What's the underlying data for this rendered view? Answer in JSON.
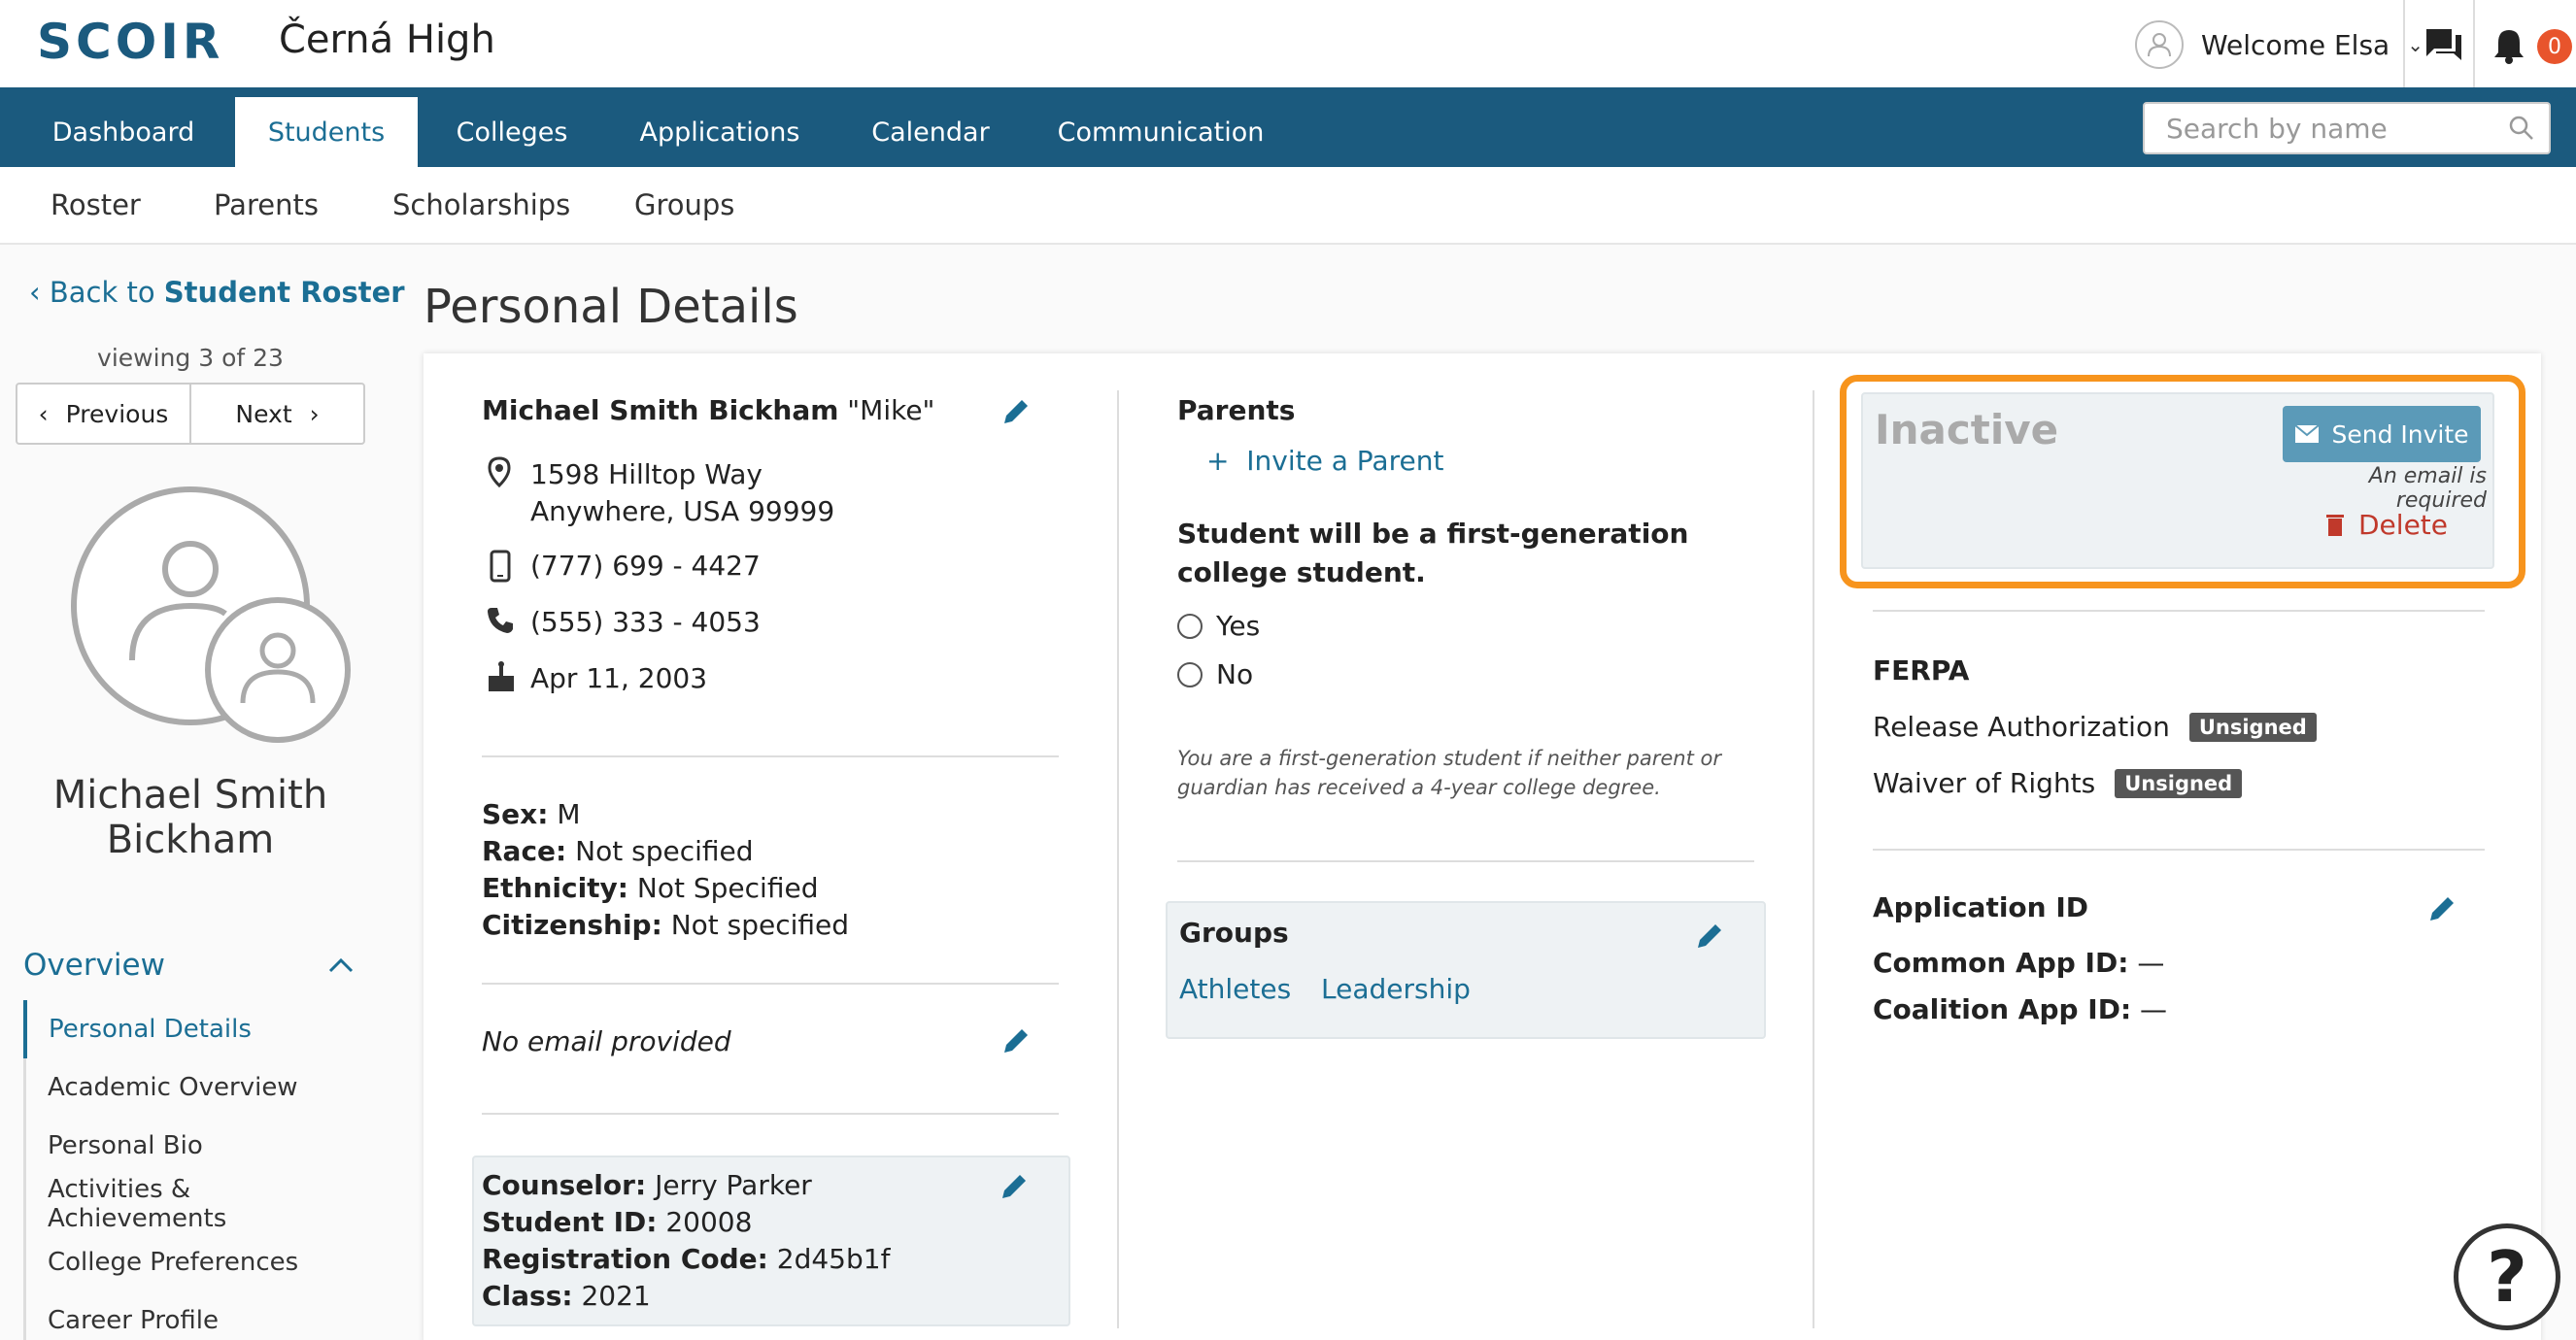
{
  "header": {
    "logo": "SCOIR",
    "school": "Černá High",
    "welcome": "Welcome Elsa",
    "notification_count": "0"
  },
  "mainnav": {
    "tabs": [
      {
        "label": "Dashboard"
      },
      {
        "label": "Students",
        "active": true
      },
      {
        "label": "Colleges"
      },
      {
        "label": "Applications"
      },
      {
        "label": "Calendar"
      },
      {
        "label": "Communication"
      }
    ],
    "search_placeholder": "Search by name"
  },
  "subnav": {
    "tabs": [
      "Roster",
      "Parents",
      "Scholarships",
      "Groups"
    ]
  },
  "sidebar": {
    "back_prefix": "Back to",
    "back_target": "Student Roster",
    "viewing": "viewing 3 of 23",
    "previous": "Previous",
    "next": "Next",
    "student_first": "Michael Smith",
    "student_last": "Bickham",
    "section": "Overview",
    "menu": [
      "Personal Details",
      "Academic Overview",
      "Personal Bio",
      "Activities & Achievements",
      "College Preferences",
      "Career Profile"
    ]
  },
  "page": {
    "title": "Personal Details"
  },
  "contact": {
    "full_name": "Michael Smith Bickham",
    "nickname": "\"Mike\"",
    "address1": "1598 Hilltop Way",
    "address2": "Anywhere, USA 99999",
    "mobile": "(777) 699 - 4427",
    "phone": "(555) 333 - 4053",
    "birthday": "Apr 11, 2003"
  },
  "demographics": {
    "sex_label": "Sex:",
    "sex": "M",
    "race_label": "Race:",
    "race": "Not specified",
    "ethnicity_label": "Ethnicity:",
    "ethnicity": "Not Specified",
    "citizenship_label": "Citizenship:",
    "citizenship": "Not specified"
  },
  "email": {
    "text": "No email provided"
  },
  "school_info": {
    "counselor_label": "Counselor:",
    "counselor": "Jerry Parker",
    "student_id_label": "Student ID:",
    "student_id": "20008",
    "reg_label": "Registration Code:",
    "reg": "2d45b1f",
    "class_label": "Class:",
    "class": "2021"
  },
  "parents": {
    "title": "Parents",
    "invite": "Invite a Parent",
    "firstgen_question": "Student will be a first-generation college student.",
    "yes": "Yes",
    "no": "No",
    "firstgen_note": "You are a first-generation student if neither parent or guardian has received a 4-year college degree."
  },
  "groups": {
    "title": "Groups",
    "items": [
      "Athletes",
      "Leadership"
    ]
  },
  "status": {
    "state": "Inactive",
    "send_invite": "Send Invite",
    "email_required": "An email is required",
    "delete": "Delete",
    "highlight_color": "#f7941d"
  },
  "ferpa": {
    "title": "FERPA",
    "release": "Release Authorization",
    "release_status": "Unsigned",
    "waiver": "Waiver of Rights",
    "waiver_status": "Unsigned"
  },
  "application_id": {
    "title": "Application ID",
    "common_label": "Common App ID:",
    "common": "—",
    "coalition_label": "Coalition App ID:",
    "coalition": "—"
  },
  "help": {
    "label": "?"
  }
}
